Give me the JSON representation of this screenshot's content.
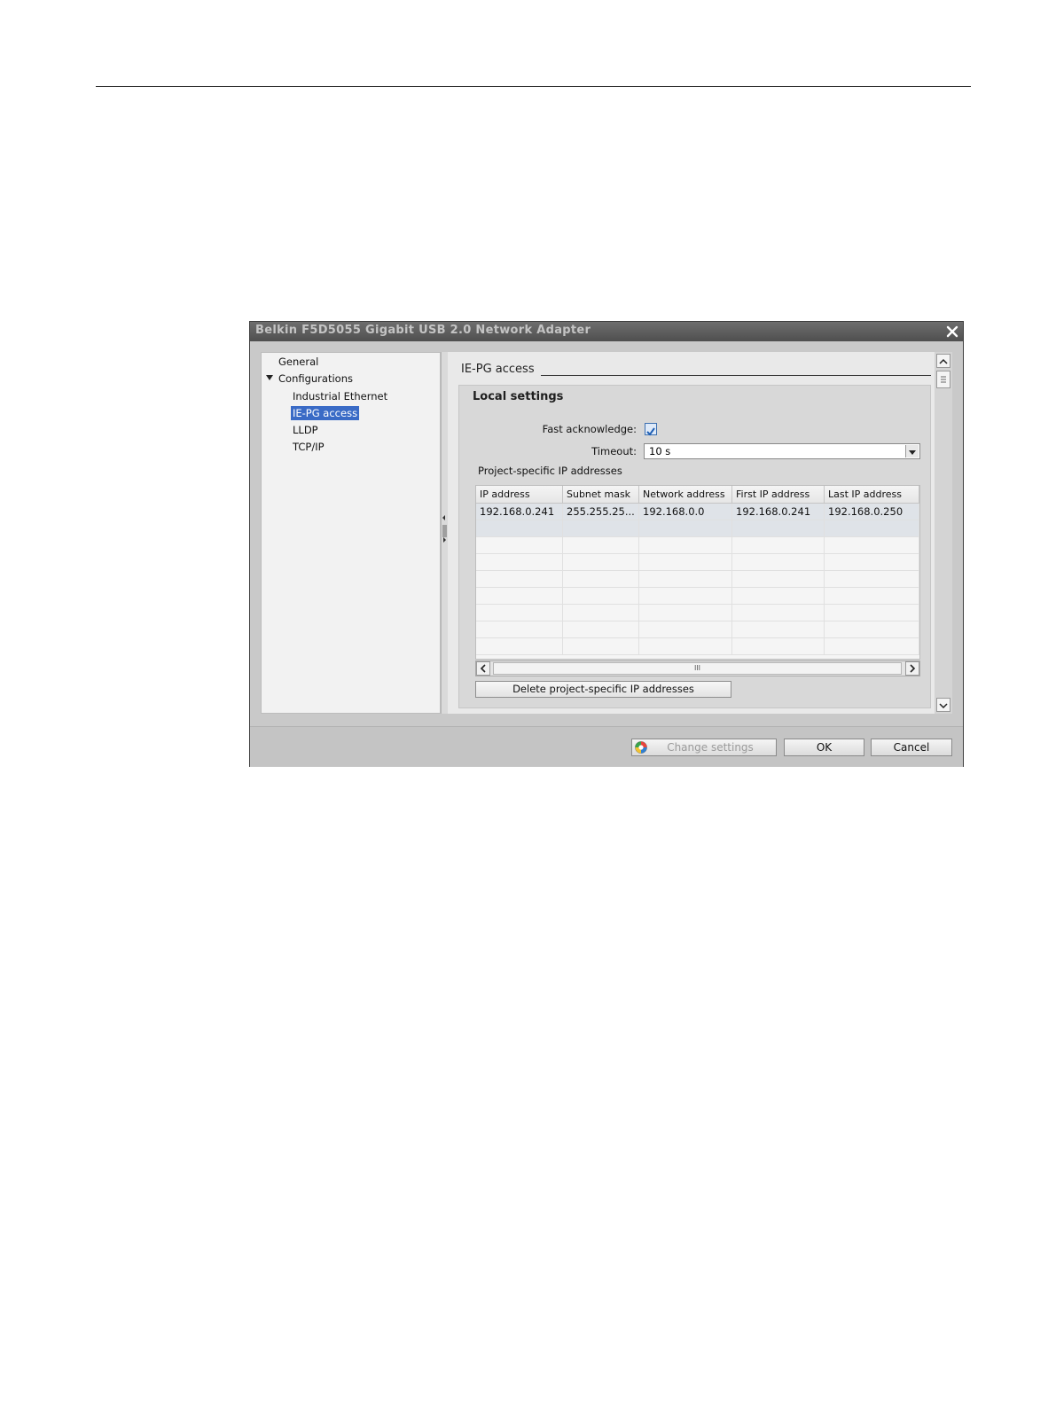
{
  "dialog": {
    "title": "Belkin F5D5055 Gigabit USB 2.0 Network Adapter"
  },
  "nav": {
    "items": [
      {
        "label": "General"
      },
      {
        "label": "Configurations"
      },
      {
        "label": "Industrial Ethernet"
      },
      {
        "label": "IE-PG access"
      },
      {
        "label": "LLDP"
      },
      {
        "label": "TCP/IP"
      }
    ],
    "selected": "IE-PG access"
  },
  "section": {
    "title": "IE-PG access"
  },
  "local_settings": {
    "title": "Local settings",
    "fast_ack_label": "Fast acknowledge:",
    "fast_ack_checked": true,
    "timeout_label": "Timeout:",
    "timeout_value": "10 s",
    "ip_section_title": "Project-specific IP addresses",
    "table": {
      "columns": [
        "IP address",
        "Subnet mask",
        "Network address",
        "First IP address",
        "Last IP address"
      ],
      "rows": [
        [
          "192.168.0.241",
          "255.255.25...",
          "192.168.0.0",
          "192.168.0.241",
          "192.168.0.250"
        ]
      ]
    },
    "scroll_grip": "III",
    "delete_button": "Delete project-specific IP addresses"
  },
  "footer": {
    "change_settings": "Change settings",
    "ok": "OK",
    "cancel": "Cancel"
  },
  "colors": {
    "selection": "#3a6bc6",
    "titlebar": "#5a5a5a",
    "checkbox": "#3c6fb0"
  }
}
